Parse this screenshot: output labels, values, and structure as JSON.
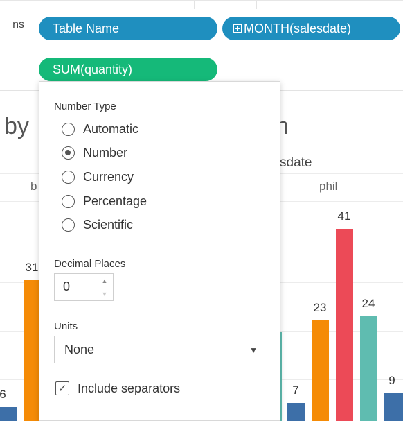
{
  "colors": {
    "pill_dimension": "#1f8fbf",
    "pill_measure": "#15b979",
    "bar_blue": "#3d6fa8",
    "bar_orange": "#f58b06",
    "bar_red": "#ec4a57",
    "bar_teal": "#5fbcb0"
  },
  "shelves": {
    "columns": {
      "label": "ns",
      "pills": [
        {
          "label": "Table Name",
          "icon": ""
        },
        {
          "label": "MONTH(salesdate)",
          "icon": "plus-box-icon"
        }
      ]
    },
    "rows": {
      "pill": {
        "label": "SUM(quantity)"
      }
    }
  },
  "chart_behind": {
    "title_fragment_left": "by",
    "title_fragment_right": "n",
    "header_fragment": "sdate",
    "pane_label_left": "b",
    "pane_label_right": "phil"
  },
  "chart_data": {
    "type": "bar",
    "title": "",
    "visible_bar_labels": [
      {
        "value": 6,
        "color": "blue"
      },
      {
        "value": 31,
        "color": "orange"
      },
      {
        "value": 7,
        "color": "blue"
      },
      {
        "value": 23,
        "color": "orange"
      },
      {
        "value": 41,
        "color": "red"
      },
      {
        "value": 24,
        "color": "teal"
      },
      {
        "value": 9,
        "color": "blue"
      }
    ],
    "ylim": [
      0,
      50
    ]
  },
  "popup": {
    "number_type": {
      "title": "Number Type",
      "options": [
        {
          "label": "Automatic",
          "selected": false
        },
        {
          "label": "Number",
          "selected": true
        },
        {
          "label": "Currency",
          "selected": false
        },
        {
          "label": "Percentage",
          "selected": false
        },
        {
          "label": "Scientific",
          "selected": false
        }
      ]
    },
    "decimal_places": {
      "title": "Decimal Places",
      "value": "0"
    },
    "units": {
      "title": "Units",
      "value": "None"
    },
    "include_separators": {
      "label": "Include separators",
      "checked": true
    }
  }
}
